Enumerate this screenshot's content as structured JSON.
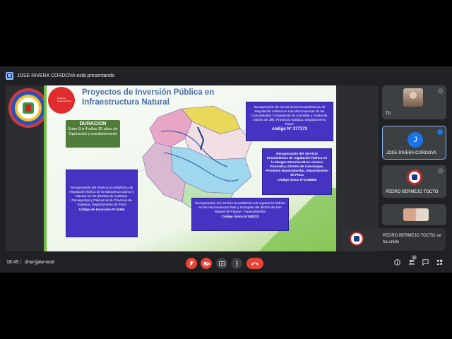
{
  "presenting_bar": {
    "text": "JOSE RIVERA CORDOVA está presentando"
  },
  "slide": {
    "title": "Proyectos de Inversión Pública en Infraestructura Natural",
    "gob_logo_text": "Gobierno Regional Piura",
    "duration": {
      "title": "DURACION",
      "body": "Entre 3 a 4 años 20 años de Operación y mantenimiento"
    },
    "projects": [
      {
        "text": "Recuperación de los Servicios Ecosistémicos de Regulación Hídrica en Las Microcuencas de las Comunidades Campesinas de Anchalay y Hualambi, Distrito de Jilili, Provincia Ayabaca, Departamento Piura\"",
        "code": "código N° 377173"
      },
      {
        "text": "Recuperación del Servicio Ecosistémico de regulación hídrica en la Margen Derecha Micro cuenca Pusmalca, Distrito de Canchaque, Provincia Huancabamba, Departamento de Piura",
        "code": "Código Único N°2335868"
      },
      {
        "text": "Recuperación del servicio ecosistémico de regulación hídrica de la subcuenca Quiroz y Macara en los distritos de Ayabaca- Pacaipampa y Paimas de la Provincia de Ayabaca, Departamento de Piura",
        "code": "Código de Inversión N°14466"
      },
      {
        "text": "Recuperación del servicio Ecosistémico de regulación hídrica en las microcuencas Pala y Uchupata del distrito de San Miguel del Faique - Huancabamba",
        "code": "Código Único N°363223"
      }
    ]
  },
  "participants": {
    "you": "Tú",
    "jose": {
      "name": "JOSE RIVERA CORDOVA",
      "initial": "J"
    },
    "pedro": "PEDRO BERMEJO TOCTO"
  },
  "toast": {
    "text": "PEDRO BERMEJO TOCTO se ha unido"
  },
  "bottom": {
    "time": "18:45",
    "separator": "|",
    "meeting_code": "dnw-jjaw-woe",
    "people_count": "20"
  },
  "colors": {
    "presenting_blue": "#8ab4f8",
    "project_box": "#4533c2",
    "duration_box": "#507c3b",
    "hangup_red": "#ea4335"
  }
}
